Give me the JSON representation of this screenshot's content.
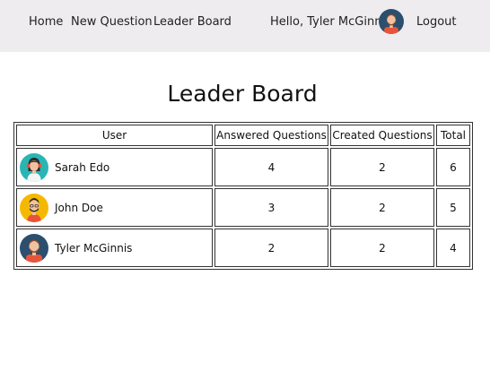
{
  "nav": {
    "home": "Home",
    "new_question": "New Question",
    "leader_board": "Leader Board",
    "greeting": "Hello, Tyler McGinnis",
    "logout": "Logout"
  },
  "page": {
    "title": "Leader Board"
  },
  "table": {
    "headers": [
      "User",
      "Answered Questions",
      "Created Questions",
      "Total"
    ],
    "rows": [
      {
        "name": "Sarah Edo",
        "answered": "4",
        "created": "2",
        "total": "6",
        "avatar_color": "#2ab5b5"
      },
      {
        "name": "John Doe",
        "answered": "3",
        "created": "2",
        "total": "5",
        "avatar_color": "#f5b800"
      },
      {
        "name": "Tyler McGinnis",
        "answered": "2",
        "created": "2",
        "total": "4",
        "avatar_color": "#2c4f6e"
      }
    ]
  },
  "colors": {
    "navbar_bg": "#eeecef",
    "shirt": "#e8543a",
    "skin": "#f2c2a0"
  }
}
